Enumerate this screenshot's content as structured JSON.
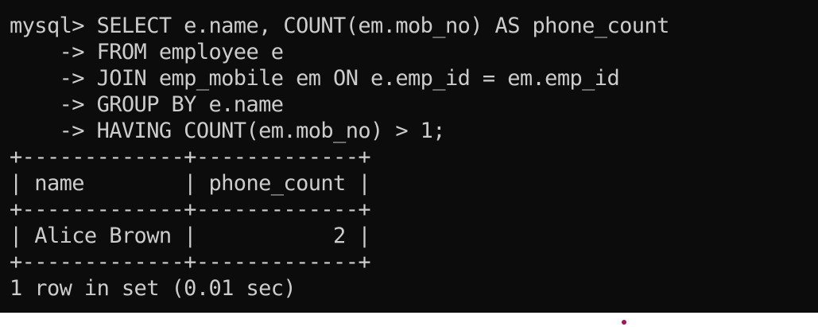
{
  "terminal": {
    "lines": [
      "mysql> SELECT e.name, COUNT(em.mob_no) AS phone_count",
      "    -> FROM employee e",
      "    -> JOIN emp_mobile em ON e.emp_id = em.emp_id",
      "    -> GROUP BY e.name",
      "    -> HAVING COUNT(em.mob_no) > 1;",
      "+-------------+-------------+",
      "| name        | phone_count |",
      "+-------------+-------------+",
      "| Alice Brown |           2 |",
      "+-------------+-------------+",
      "1 row in set (0.01 sec)"
    ]
  },
  "colors": {
    "terminal_bg": "#0c0c0c",
    "terminal_fg": "#cccccc",
    "cursor_dot": "#a0155e"
  }
}
